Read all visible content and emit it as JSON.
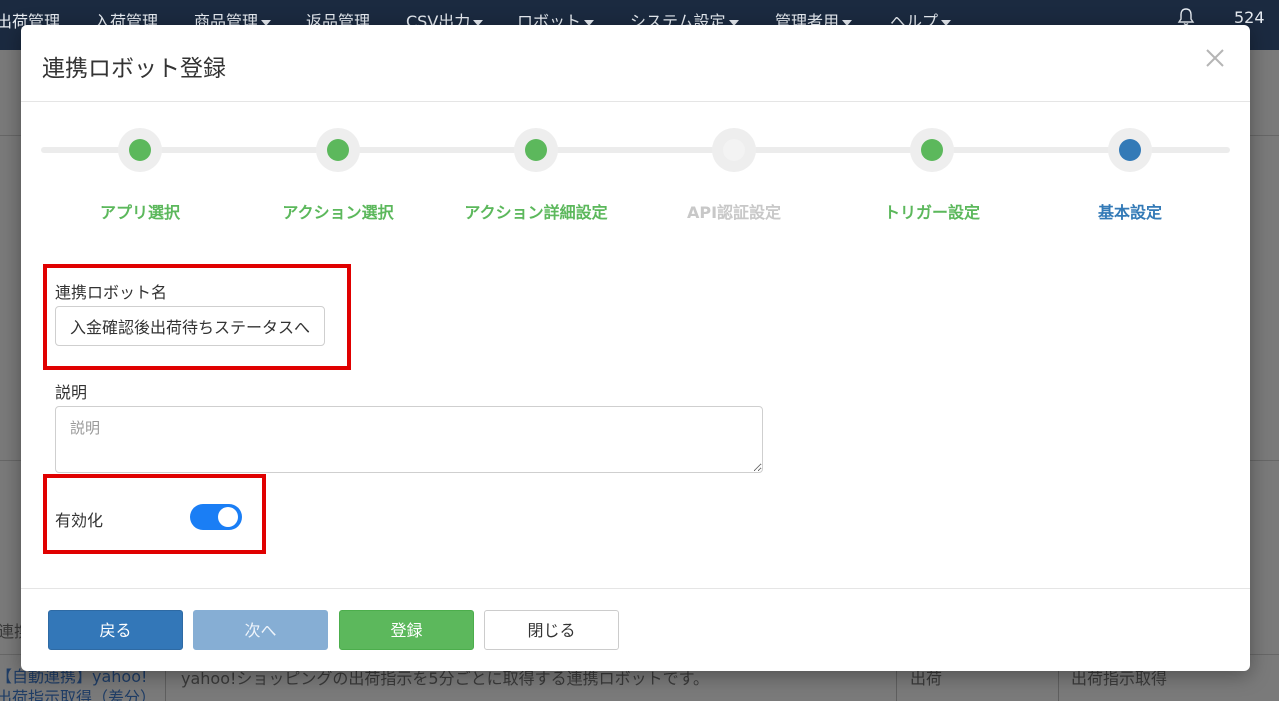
{
  "nav": {
    "items": [
      {
        "label": "出荷管理",
        "caret": false
      },
      {
        "label": "入荷管理",
        "caret": false
      },
      {
        "label": "商品管理",
        "caret": true
      },
      {
        "label": "返品管理",
        "caret": false
      },
      {
        "label": "CSV出力",
        "caret": true
      },
      {
        "label": "ロボット",
        "caret": true
      },
      {
        "label": "システム設定",
        "caret": true
      },
      {
        "label": "管理者用",
        "caret": true
      },
      {
        "label": "ヘルプ",
        "caret": true
      }
    ],
    "bell_icon": "bell-icon",
    "count": "524"
  },
  "background": {
    "row_header": "連携",
    "row_name_line1": "【自動連携】yahoo!",
    "row_name_line2": "出荷指示取得（差分）",
    "row_description": "yahoo!ショッピングの出荷指示を5分ごとに取得する連携ロボットです。",
    "row_type": "出荷",
    "row_action": "出荷指示取得"
  },
  "modal": {
    "title": "連携ロボット登録",
    "close_icon": "close-icon",
    "steps": [
      {
        "label": "アプリ選択",
        "state": "done"
      },
      {
        "label": "アクション選択",
        "state": "done"
      },
      {
        "label": "アクション詳細設定",
        "state": "done"
      },
      {
        "label": "API認証設定",
        "state": "skipped"
      },
      {
        "label": "トリガー設定",
        "state": "done"
      },
      {
        "label": "基本設定",
        "state": "current"
      }
    ],
    "colors": {
      "done": "#5cb85c",
      "skipped": "#c8c8c8",
      "current": "#337ab7",
      "highlight": "#e00000",
      "toggle_on": "#1a7ef5"
    },
    "form": {
      "name_label": "連携ロボット名",
      "name_value": "入金確認後出荷待ちステータスへ",
      "description_label": "説明",
      "description_placeholder": "説明",
      "enabled_label": "有効化",
      "enabled": true
    },
    "buttons": {
      "back": "戻る",
      "next": "次へ",
      "register": "登録",
      "close": "閉じる"
    }
  }
}
